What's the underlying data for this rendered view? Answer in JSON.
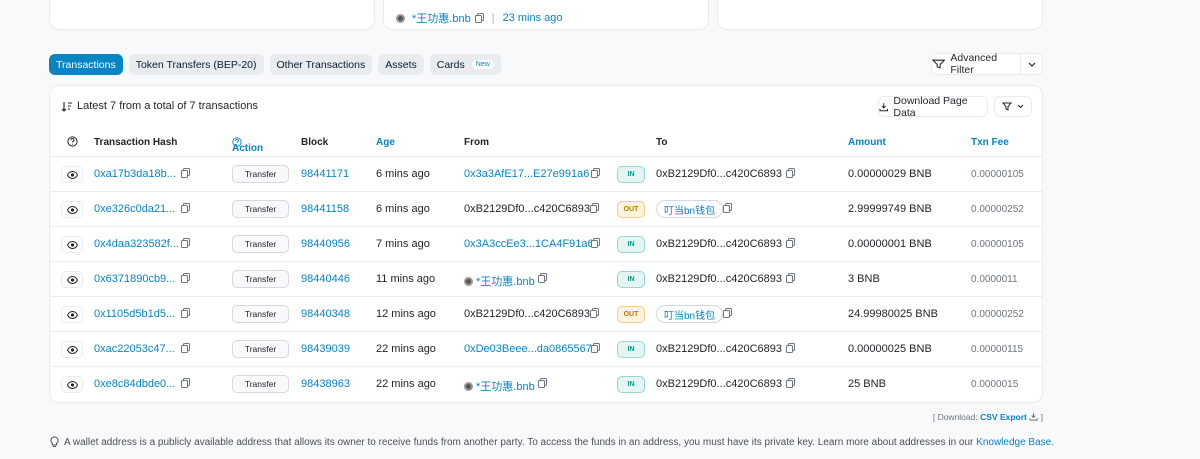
{
  "top_cards": {
    "middle_name": "*王功惠.bnb",
    "separator": "|",
    "middle_age": "23 mins ago"
  },
  "tabs": [
    {
      "label": "Transactions",
      "active": true
    },
    {
      "label": "Token Transfers (BEP-20)"
    },
    {
      "label": "Other Transactions"
    },
    {
      "label": "Assets"
    },
    {
      "label": "Cards",
      "badge": "New"
    }
  ],
  "filter": {
    "advanced_label": "Advanced Filter"
  },
  "summary": {
    "text": "Latest 7 from a total of 7 transactions"
  },
  "toolbar": {
    "download_label": "Download Page Data"
  },
  "table": {
    "headers": {
      "hash": "Transaction Hash",
      "action": "Action",
      "block": "Block",
      "age": "Age",
      "from": "From",
      "to": "To",
      "amount": "Amount",
      "fee": "Txn Fee"
    },
    "rows": [
      {
        "hash": "0xa17b3da18b...",
        "method": "Transfer",
        "block": "98441171",
        "age": "6 mins ago",
        "from": "0x3a3AfE17...E27e991a6",
        "from_link": true,
        "dir": "IN",
        "to": "0xB2129Df0...c420C6893",
        "to_link": false,
        "amount": "0.00000029 BNB",
        "fee": "0.00000105"
      },
      {
        "hash": "0xe326c0da21...",
        "method": "Transfer",
        "block": "98441158",
        "age": "6 mins ago",
        "from": "0xB2129Df0...c420C6893",
        "from_link": false,
        "dir": "OUT",
        "to": "叮当bn钱包",
        "to_link": true,
        "to_tag": true,
        "amount": "2.99999749 BNB",
        "fee": "0.00000252"
      },
      {
        "hash": "0x4daa323582f...",
        "method": "Transfer",
        "block": "98440956",
        "age": "7 mins ago",
        "from": "0x3A3ccEe3...1CA4F91a6",
        "from_link": true,
        "dir": "IN",
        "to": "0xB2129Df0...c420C6893",
        "to_link": false,
        "amount": "0.00000001 BNB",
        "fee": "0.00000105"
      },
      {
        "hash": "0x6371890cb9...",
        "method": "Transfer",
        "block": "98440446",
        "age": "11 mins ago",
        "from": "*王功惠.bnb",
        "from_link": true,
        "from_ens": true,
        "dir": "IN",
        "to": "0xB2129Df0...c420C6893",
        "to_link": false,
        "amount": "3 BNB",
        "fee": "0.0000011"
      },
      {
        "hash": "0x1105d5b1d5...",
        "method": "Transfer",
        "block": "98440348",
        "age": "12 mins ago",
        "from": "0xB2129Df0...c420C6893",
        "from_link": false,
        "dir": "OUT",
        "to": "叮当bn钱包",
        "to_link": true,
        "to_tag": true,
        "amount": "24.99980025 BNB",
        "fee": "0.00000252"
      },
      {
        "hash": "0xac22053c47...",
        "method": "Transfer",
        "block": "98439039",
        "age": "22 mins ago",
        "from": "0xDe03Beee...da0865567",
        "from_link": true,
        "dir": "IN",
        "to": "0xB2129Df0...c420C6893",
        "to_link": false,
        "amount": "0.00000025 BNB",
        "fee": "0.00000115"
      },
      {
        "hash": "0xe8c84dbde0...",
        "method": "Transfer",
        "block": "98438963",
        "age": "22 mins ago",
        "from": "*王功惠.bnb",
        "from_link": true,
        "from_ens": true,
        "dir": "IN",
        "to": "0xB2129Df0...c420C6893",
        "to_link": false,
        "amount": "25 BNB",
        "fee": "0.0000015"
      }
    ]
  },
  "download": {
    "prefix": "[ Download:",
    "link": "CSV Export",
    "suffix": "]"
  },
  "footnote": {
    "text": "A wallet address is a publicly available address that allows its owner to receive funds from another party. To access the funds in an address, you must have its private key. Learn more about addresses in our",
    "link": "Knowledge Base",
    "end": "."
  },
  "colors": {
    "accent": "#0784c3",
    "in": "#00a186",
    "out": "#db9a04"
  }
}
